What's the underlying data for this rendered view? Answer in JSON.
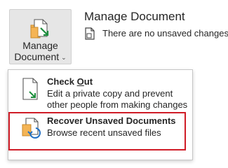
{
  "ribbon": {
    "manage_label_line1": "Manage",
    "manage_label_line2": "Document",
    "manage_caret": "⌄",
    "manage_icon": "manage-document-icon"
  },
  "info": {
    "title": "Manage Document",
    "status_text": "There are no unsaved changes.",
    "status_icon": "document-icon"
  },
  "menu": {
    "items": [
      {
        "title_prefix": "Check ",
        "title_key": "O",
        "title_suffix": "ut",
        "description": "Edit a private copy and prevent other people from making changes",
        "icon": "check-out-icon"
      },
      {
        "title": "Recover Unsaved Documents",
        "description": "Browse recent unsaved files",
        "icon": "recover-unsaved-icon"
      }
    ]
  },
  "colors": {
    "accent_green": "#1e8e3e",
    "accent_blue": "#1f6fc5",
    "folder_orange": "#f4b455",
    "highlight_red": "#d01c27"
  }
}
